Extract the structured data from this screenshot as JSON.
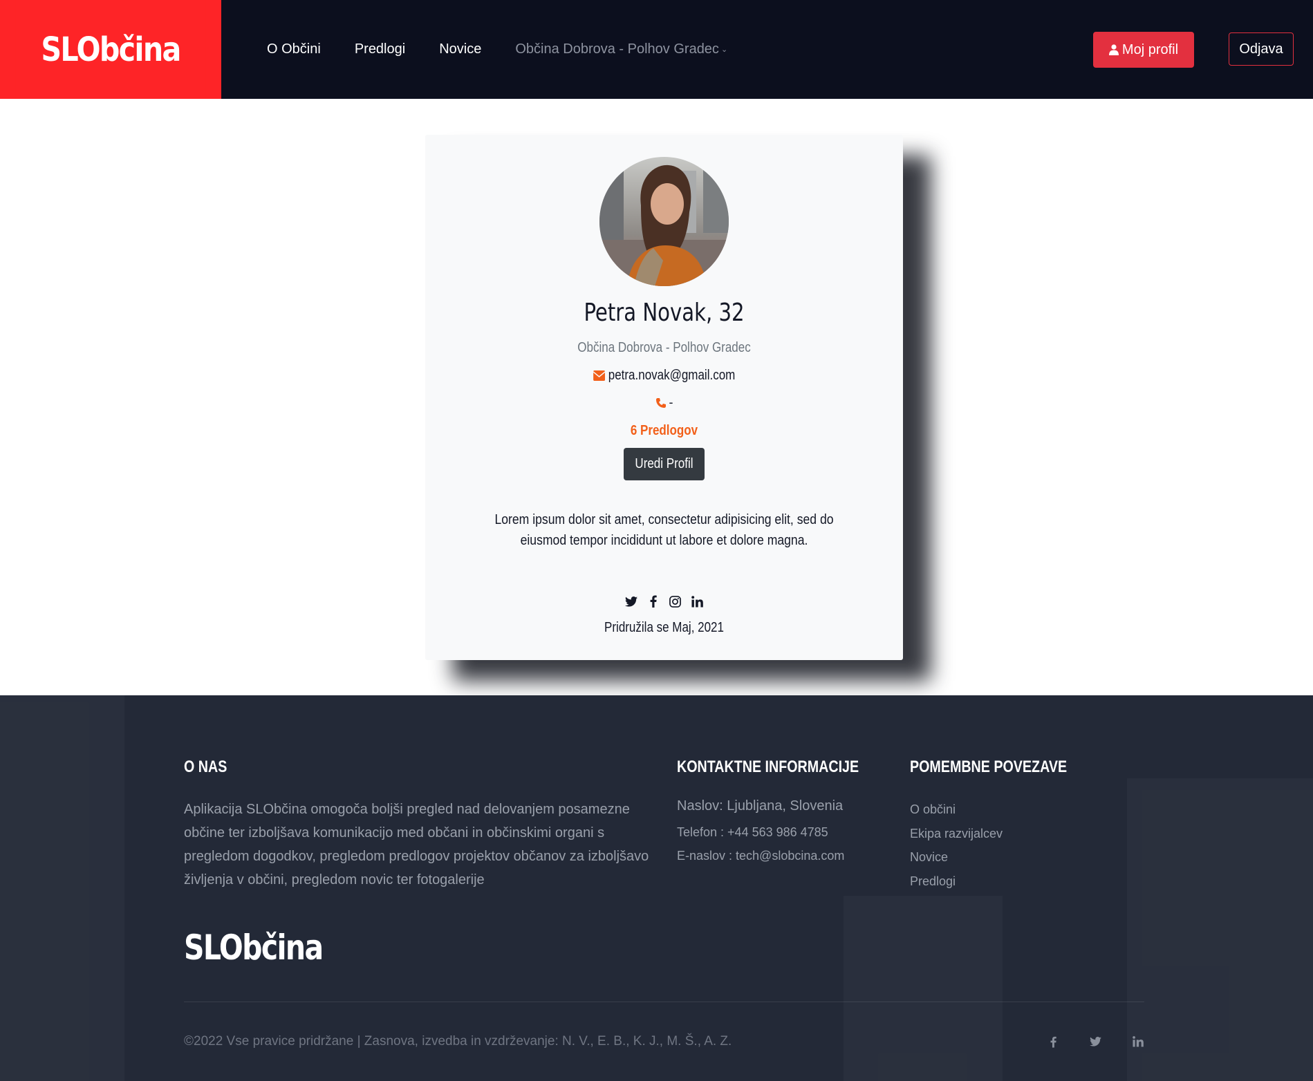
{
  "header": {
    "brand": "SLObčina",
    "nav": [
      "O Občini",
      "Predlogi",
      "Novice"
    ],
    "municipality_select": "Občina Dobrova - Polhov Gradec",
    "profile_button": "Moj profil",
    "logout_button": "Odjava"
  },
  "profile": {
    "name": "Petra Novak, 32",
    "municipality": "Občina Dobrova - Polhov Gradec",
    "email": "petra.novak@gmail.com",
    "phone": "-",
    "proposals": "6 Predlogov",
    "edit_button": "Uredi Profil",
    "bio": "Lorem ipsum dolor sit amet, consectetur adipisicing elit, sed do eiusmod tempor incididunt ut labore et dolore magna.",
    "socials": [
      "twitter-icon",
      "facebook-icon",
      "instagram-icon",
      "linkedin-icon"
    ],
    "joined": "Pridružila se Maj, 2021"
  },
  "footer": {
    "about_title": "O NAS",
    "about_text": "Aplikacija SLObčina omogoča boljši pregled nad delovanjem posamezne občine ter izboljšava komunikacijo med občani in občinskimi organi s pregledom dogodkov, pregledom predlogov projektov občanov za izboljšavo življenja v občini, pregledom novic ter fotogalerije",
    "contact_title": "KONTAKTNE INFORMACIJE",
    "address": "Naslov: Ljubljana, Slovenia",
    "phone": "Telefon : +44 563 986 4785",
    "email": "E-naslov : tech@slobcina.com",
    "links_title": "POMEMBNE POVEZAVE",
    "links": [
      "O občini",
      "Ekipa razvijalcev",
      "Novice",
      "Predlogi"
    ],
    "brand": "SLObčina",
    "copyright": "©2022 Vse pravice pridržane | Zasnova, izvedba in vzdrževanje: N. V., E. B., K. J., M. Š., A. Z.",
    "social_icons": [
      "facebook-icon",
      "twitter-icon",
      "linkedin-icon"
    ]
  },
  "colors": {
    "brand_red": "#fe2427",
    "accent_red": "#e3303f",
    "accent_orange": "#f2601a",
    "navbar": "#0c0f1e",
    "footer": "#232937"
  }
}
